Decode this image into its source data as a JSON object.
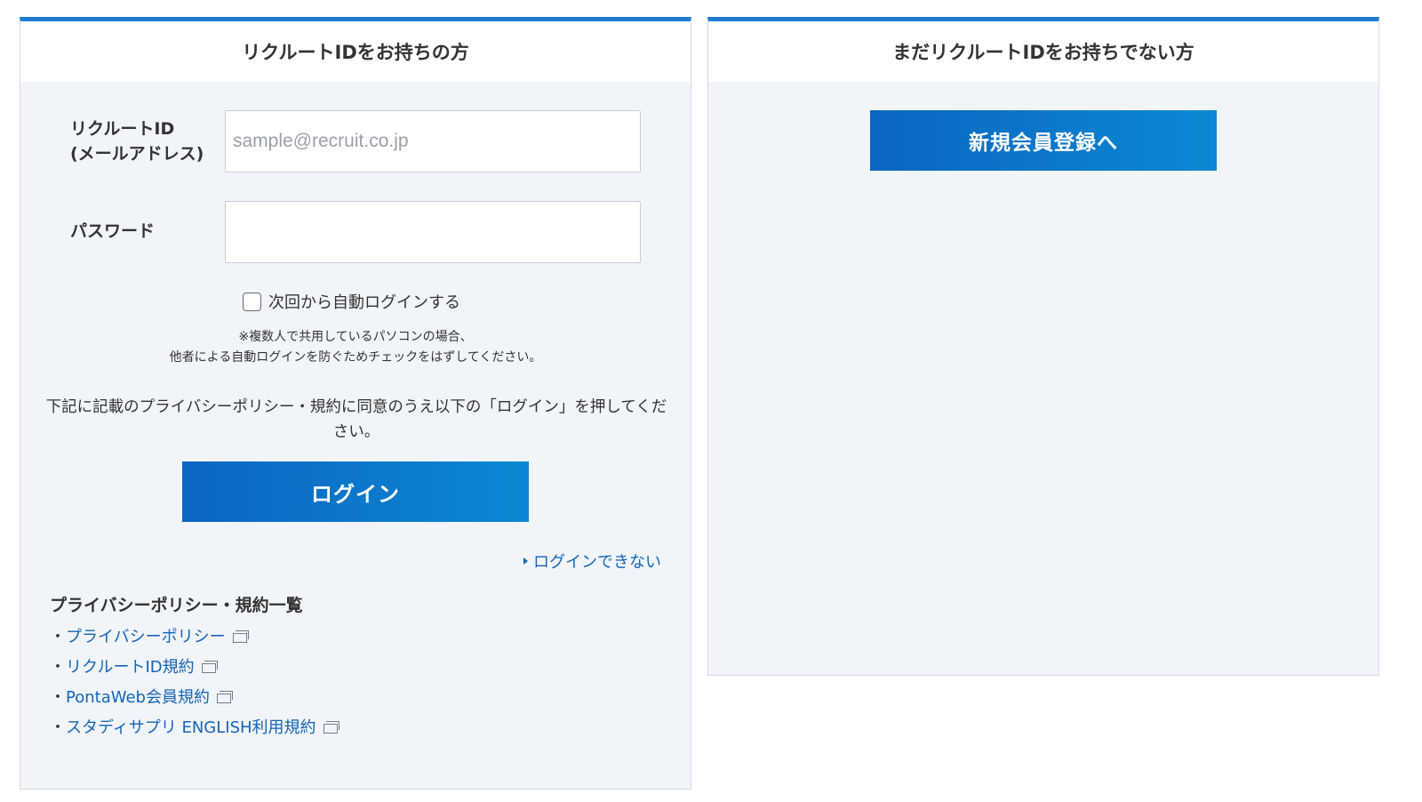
{
  "login_panel": {
    "title": "リクルートIDをお持ちの方",
    "id_label_line1": "リクルートID",
    "id_label_line2": "(メールアドレス)",
    "id_placeholder": "sample@recruit.co.jp",
    "id_value": "",
    "password_label": "パスワード",
    "password_value": "",
    "remember_label": "次回から自動ログインする",
    "remember_checked": false,
    "note_line1": "※複数人で共用しているパソコンの場合、",
    "note_line2": "他者による自動ログインを防ぐためチェックをはずしてください。",
    "agree_text": "下記に記載のプライバシーポリシー・規約に同意のうえ以下の「ログイン」を押してください。",
    "login_button": "ログイン",
    "cant_login_link": "ログインできない",
    "terms_title": "プライバシーポリシー・規約一覧",
    "terms_bullet": "・",
    "terms": [
      {
        "label": "プライバシーポリシー"
      },
      {
        "label": "リクルートID規約"
      },
      {
        "label": "PontaWeb会員規約"
      },
      {
        "label": "スタディサプリ ENGLISH利用規約"
      }
    ]
  },
  "register_panel": {
    "title": "まだリクルートIDをお持ちでない方",
    "register_button": "新規会員登録へ"
  },
  "colors": {
    "accent_border": "#1e7fd0",
    "button_gradient_start": "#0a66c2",
    "button_gradient_end": "#0d88d3",
    "link": "#1565b8",
    "panel_bg": "#f1f4f9"
  },
  "icons": {
    "checkbox": "checkbox-icon",
    "link_arrow": "triangle-right-icon",
    "external": "external-window-icon"
  }
}
